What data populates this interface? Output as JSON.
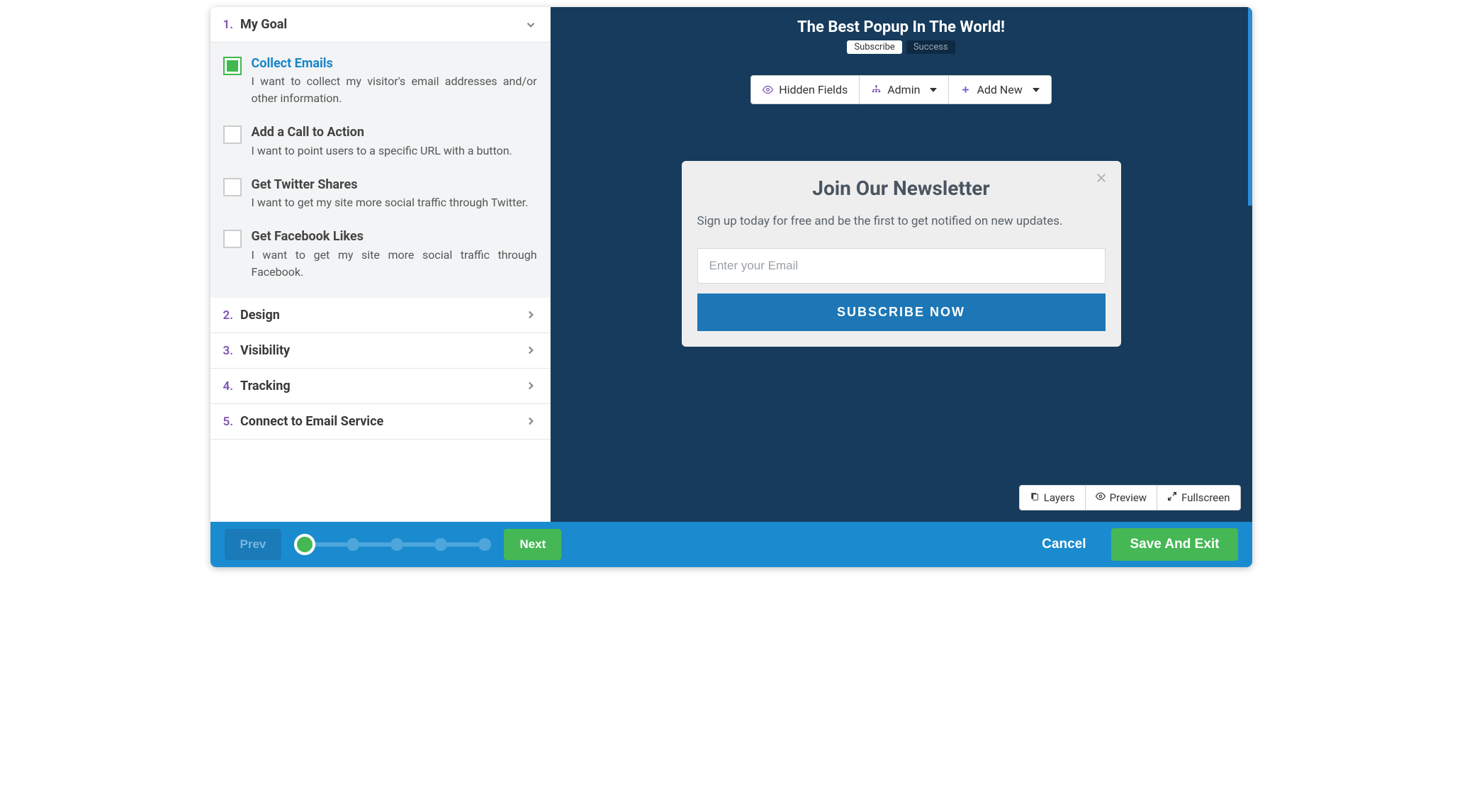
{
  "sidebar": {
    "sections": [
      {
        "num": "1.",
        "label": "My Goal",
        "expanded": true
      },
      {
        "num": "2.",
        "label": "Design",
        "expanded": false
      },
      {
        "num": "3.",
        "label": "Visibility",
        "expanded": false
      },
      {
        "num": "4.",
        "label": "Tracking",
        "expanded": false
      },
      {
        "num": "5.",
        "label": "Connect to Email Service",
        "expanded": false
      }
    ],
    "goals": [
      {
        "title": "Collect Emails",
        "desc": "I want to collect my visitor's email addresses and/or other information.",
        "selected": true
      },
      {
        "title": "Add a Call to Action",
        "desc": "I want to point users to a specific URL with a button.",
        "selected": false
      },
      {
        "title": "Get Twitter Shares",
        "desc": "I want to get my site more social traffic through Twitter.",
        "selected": false
      },
      {
        "title": "Get Facebook Likes",
        "desc": "I want to get my site more social traffic through Facebook.",
        "selected": false
      }
    ]
  },
  "canvas": {
    "title": "The Best Popup In The World!",
    "tabs": {
      "subscribe": "Subscribe",
      "success": "Success"
    },
    "toolbar": {
      "hidden_fields": "Hidden Fields",
      "admin": "Admin",
      "add_new": "Add New"
    },
    "popup": {
      "heading": "Join Our Newsletter",
      "body": "Sign up today for free and be the first to get notified on new updates.",
      "placeholder": "Enter your Email",
      "button": "SUBSCRIBE NOW"
    },
    "view_controls": {
      "layers": "Layers",
      "preview": "Preview",
      "fullscreen": "Fullscreen"
    }
  },
  "footer": {
    "prev": "Prev",
    "next": "Next",
    "cancel": "Cancel",
    "save": "Save And Exit",
    "current_step": 1,
    "total_steps": 5
  }
}
